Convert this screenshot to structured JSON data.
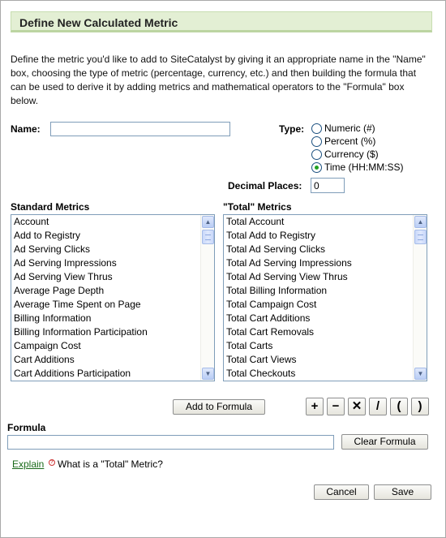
{
  "dialog": {
    "title": "Define New Calculated Metric",
    "intro": "Define the metric you'd like to add to SiteCatalyst by giving it an appropriate name in the \"Name\" box, choosing the type of metric (percentage, currency, etc.) and then building the formula that can be used to derive it by adding metrics and mathematical operators to the \"Formula\" box below."
  },
  "name_field": {
    "label": "Name:",
    "value": ""
  },
  "type": {
    "label": "Type:",
    "options": [
      "Numeric (#)",
      "Percent (%)",
      "Currency ($)",
      "Time (HH:MM:SS)"
    ],
    "selected": "Time (HH:MM:SS)"
  },
  "decimal_places": {
    "label": "Decimal Places:",
    "value": "0"
  },
  "standard_metrics": {
    "label": "Standard Metrics",
    "items": [
      "Account",
      "Add to Registry",
      "Ad Serving Clicks",
      "Ad Serving Impressions",
      "Ad Serving View Thrus",
      "Average Page Depth",
      "Average Time Spent on Page",
      "Billing Information",
      "Billing Information Participation",
      "Campaign Cost",
      "Cart Additions",
      "Cart Additions Participation"
    ]
  },
  "total_metrics": {
    "label": "\"Total\" Metrics",
    "items": [
      "Total Account",
      "Total Add to Registry",
      "Total Ad Serving Clicks",
      "Total Ad Serving Impressions",
      "Total Ad Serving View Thrus",
      "Total Billing Information",
      "Total Campaign Cost",
      "Total Cart Additions",
      "Total Cart Removals",
      "Total Carts",
      "Total Cart Views",
      "Total Checkouts"
    ]
  },
  "buttons": {
    "add_to_formula": "Add to Formula",
    "clear_formula": "Clear Formula",
    "cancel": "Cancel",
    "save": "Save"
  },
  "operators": [
    "+",
    "−",
    "✕",
    "/",
    "(",
    ")"
  ],
  "formula": {
    "label": "Formula",
    "value": ""
  },
  "help": {
    "explain_link": "Explain",
    "question": "What is a \"Total\" Metric?"
  },
  "colors": {
    "title_bg": "#e3efd4",
    "link": "#1a6a1a",
    "radio_selected": "#21a121"
  }
}
